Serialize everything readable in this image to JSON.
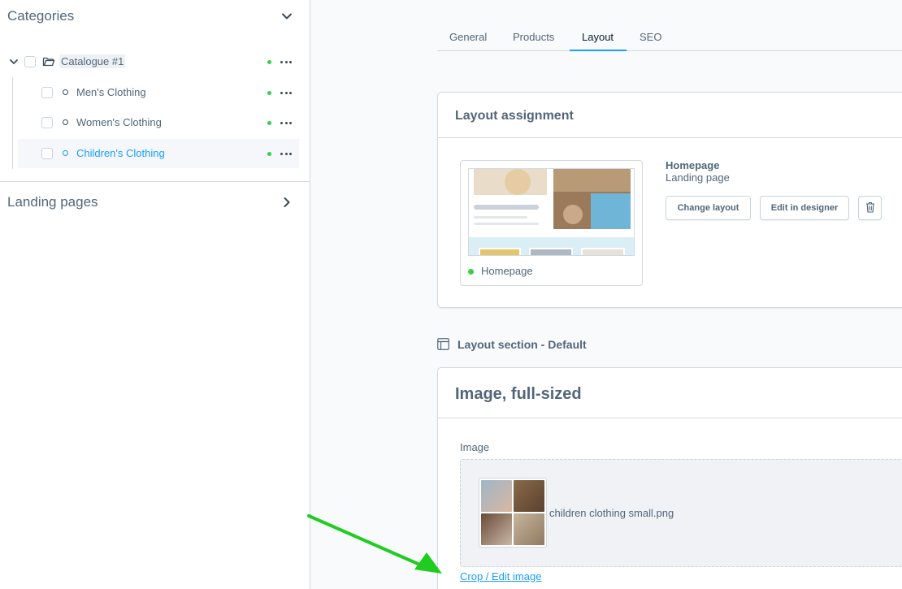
{
  "sidebar": {
    "categories_title": "Categories",
    "landing_pages_title": "Landing pages",
    "tree": {
      "root": "Catalogue #1",
      "children": [
        {
          "label": "Men's Clothing"
        },
        {
          "label": "Women's Clothing"
        },
        {
          "label": "Children's Clothing"
        }
      ]
    }
  },
  "tabs": [
    {
      "label": "General"
    },
    {
      "label": "Products"
    },
    {
      "label": "Layout"
    },
    {
      "label": "SEO"
    }
  ],
  "layout_assignment": {
    "title": "Layout assignment",
    "preview_label": "Homepage",
    "layout_name": "Homepage",
    "layout_type": "Landing page",
    "change_layout_label": "Change layout",
    "edit_designer_label": "Edit in designer"
  },
  "section": {
    "title": "Layout section - Default"
  },
  "image_block": {
    "title": "Image, full-sized",
    "field_label": "Image",
    "file_name": "children clothing small.png",
    "crop_link": "Crop / Edit image"
  },
  "colors": {
    "accent": "#189eff",
    "active_status": "#37d046",
    "annotation_arrow": "#1fcc1f"
  }
}
